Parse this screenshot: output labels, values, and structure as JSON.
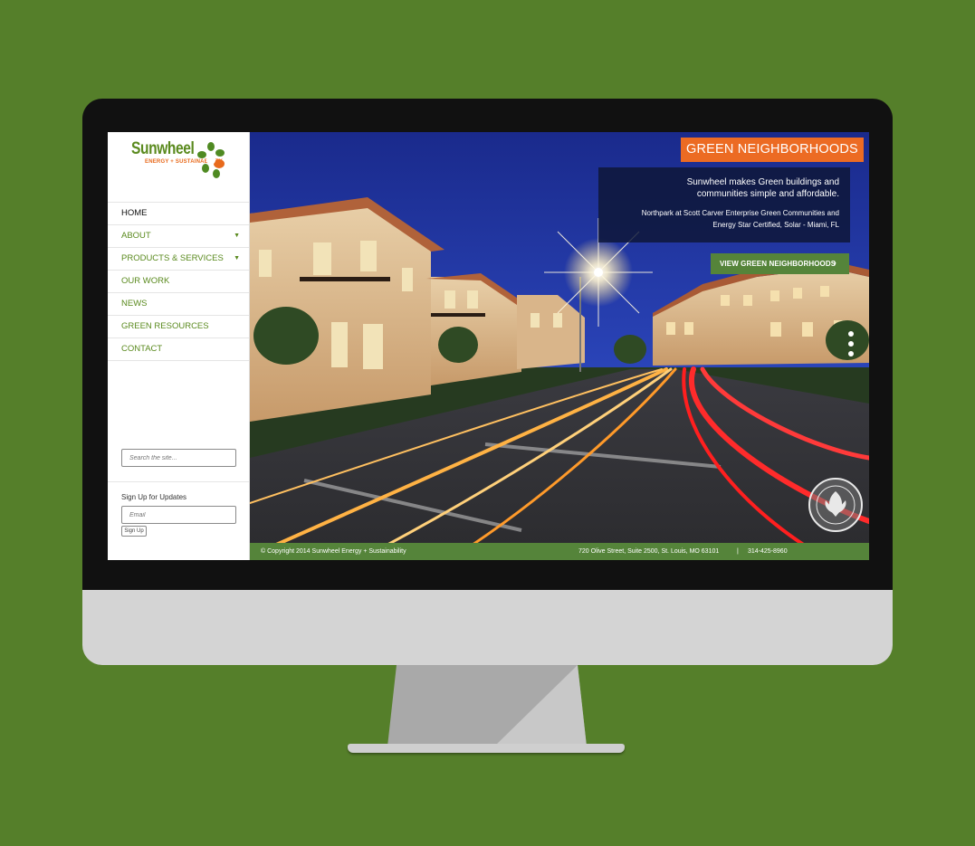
{
  "logo": {
    "name": "Sunwheel",
    "tagline": "ENERGY + SUSTAINABILITY"
  },
  "nav": [
    {
      "label": "HOME",
      "has_submenu": false,
      "active": true
    },
    {
      "label": "ABOUT",
      "has_submenu": true
    },
    {
      "label": "PRODUCTS & SERVICES",
      "has_submenu": true
    },
    {
      "label": "OUR WORK",
      "has_submenu": false
    },
    {
      "label": "NEWS",
      "has_submenu": false
    },
    {
      "label": "GREEN RESOURCES",
      "has_submenu": false
    },
    {
      "label": "CONTACT",
      "has_submenu": false
    }
  ],
  "nav_caret": "▼",
  "search": {
    "placeholder": "Search the site..."
  },
  "signup": {
    "label": "Sign Up for Updates",
    "email_placeholder": "Email",
    "button": "Sign Up"
  },
  "hero": {
    "tag": "GREEN NEIGHBORHOODS",
    "headline_line1": "Sunwheel makes Green buildings and",
    "headline_line2": "communities simple and affordable.",
    "sub_line1": "Northpark at Scott Carver Enterprise Green Communities and",
    "sub_line2": "Energy Star Certified, Solar - Miami, FL",
    "cta": "VIEW GREEN NEIGHBORHOODS",
    "cta_icon": "chevron-right-icon",
    "slide_count": 3
  },
  "footer": {
    "copyright": "© Copyright 2014 Sunwheel Energy + Sustainability",
    "address": "720 Olive Street, Suite 2500, St. Louis, MO 63101",
    "separator": "|",
    "phone": "314-425-8960"
  },
  "colors": {
    "background": "#557f2a",
    "brand_green": "#5a8a1e",
    "accent_orange": "#ec6b23",
    "footer_green": "#55843a"
  }
}
